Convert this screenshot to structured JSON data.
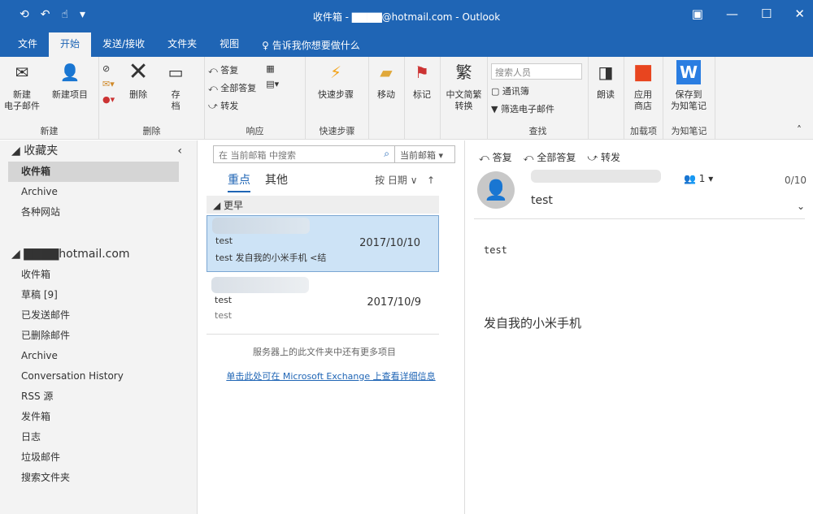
{
  "window": {
    "title": "收件箱 - ▇▇▇▇@hotmail.com - Outlook",
    "minimize": "—",
    "maximize": "☐",
    "close": "✕",
    "restore_ribbon": "▣"
  },
  "tabs": [
    "文件",
    "开始",
    "发送/接收",
    "文件夹",
    "视图"
  ],
  "tell_me": "告诉我你想要做什么",
  "ribbon": {
    "new": {
      "label": "新建",
      "new_email": "新建\n电子邮件",
      "new_item": "新建项目"
    },
    "delete": {
      "label": "删除",
      "delete": "删除",
      "archive": "存\n档"
    },
    "respond": {
      "label": "响应",
      "reply": "答复",
      "reply_all": "全部答复",
      "forward": "转发"
    },
    "quick": {
      "label": "快速步骤",
      "quick_steps": "快速步骤"
    },
    "move": "移动",
    "tags": "标记",
    "convert": "中文简繁\n转换",
    "find": {
      "label": "查找",
      "search_people": "搜索人员",
      "address_book": "通讯簿",
      "filter": "筛选电子邮件"
    },
    "read_aloud": "朗读",
    "addins": {
      "label": "加载项",
      "store": "应用\n商店"
    },
    "wiz": {
      "label": "为知笔记",
      "save": "保存到\n为知笔记"
    }
  },
  "nav": {
    "favorites": "收藏夹",
    "fav_items": [
      "收件箱",
      "Archive",
      "各种网站"
    ],
    "account": "▇▇▇▇hotmail.com",
    "items": [
      "收件箱",
      "草稿 [9]",
      "已发送邮件",
      "已删除邮件",
      "Archive",
      "Conversation History",
      "RSS 源",
      "发件箱",
      "日志",
      "垃圾邮件",
      "搜索文件夹"
    ]
  },
  "list": {
    "search_placeholder": "在 当前邮箱 中搜索",
    "scope": "当前邮箱",
    "tab_focused": "重点",
    "tab_other": "其他",
    "sort": "按 日期 ∨",
    "sort_dir": "↑",
    "group": "更早",
    "mails": [
      {
        "subject": "test",
        "date": "2017/10/10",
        "preview": "test 发自我的小米手机 <结"
      },
      {
        "subject": "test",
        "date": "2017/10/9",
        "preview": "test"
      }
    ],
    "more_note": "服务器上的此文件夹中还有更多项目",
    "more_link": "单击此处可在 Microsoft Exchange 上查看详细信息"
  },
  "reading": {
    "reply": "答复",
    "reply_all": "全部答复",
    "forward": "转发",
    "people": "1 ▾",
    "count": "0/10",
    "subject": "test",
    "body_line1": "test",
    "body_line2": "发自我的小米手机"
  }
}
